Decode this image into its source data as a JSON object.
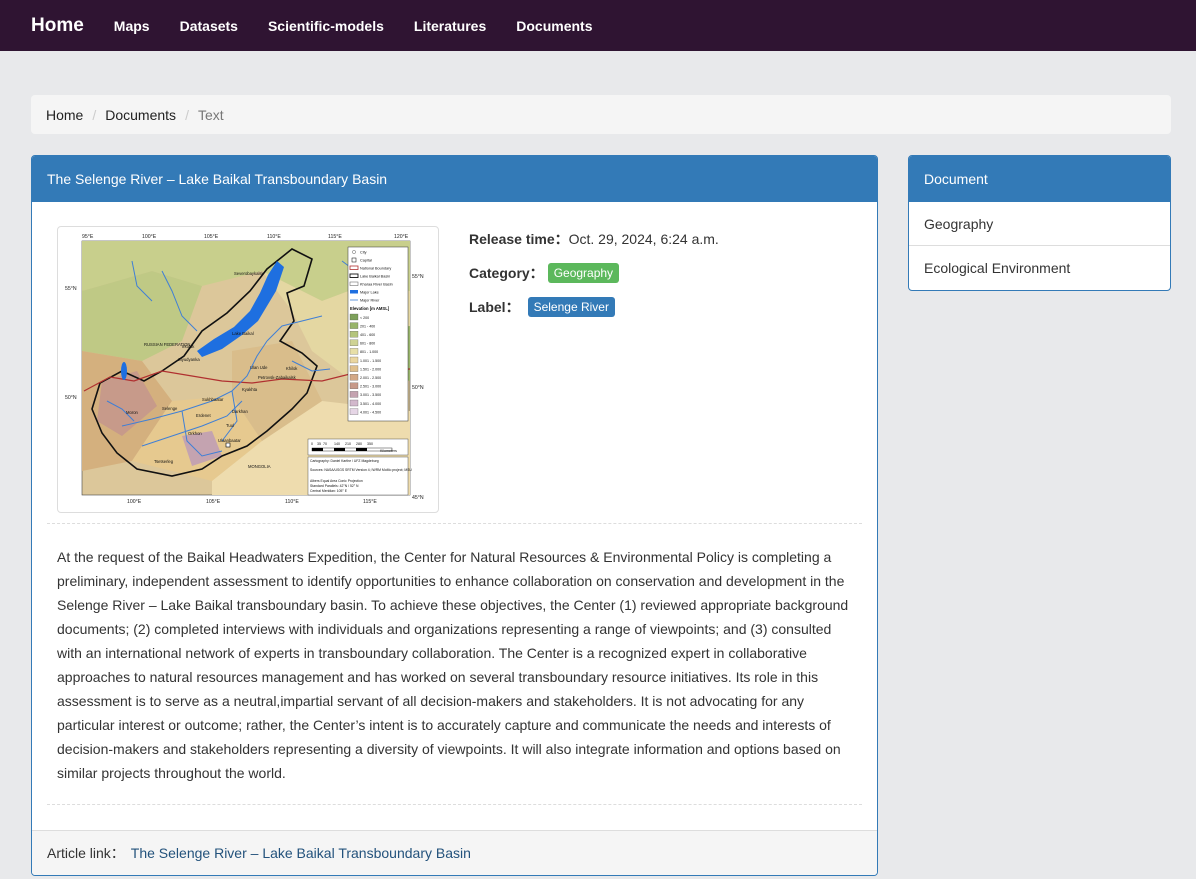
{
  "nav": {
    "brand": "Home",
    "links": [
      "Maps",
      "Datasets",
      "Scientific-models",
      "Literatures",
      "Documents"
    ]
  },
  "breadcrumb": {
    "items": [
      "Home",
      "Documents"
    ],
    "separator": "/",
    "active": "Text"
  },
  "article": {
    "title": "The Selenge River – Lake Baikal Transboundary Basin",
    "release_label": "Release time：",
    "release_value": "Oct. 29, 2024, 6:24 a.m.",
    "category_label": "Category：",
    "category_value": "Geography",
    "tag_label": "Label：",
    "tag_value": "Selenge River",
    "body": "At the request of the Baikal Headwaters Expedition, the Center for Natural Resources & Environmental Policy is completing a preliminary, independent assessment to identify opportunities to enhance collaboration on conservation and development in the Selenge River – Lake Baikal transboundary basin. To achieve these objectives, the Center (1) reviewed appropriate background documents; (2) completed interviews with individuals and organizations representing a range of viewpoints; and (3) consulted with an international network of experts in transboundary collaboration. The Center is a recognized expert in collaborative approaches to natural resources management and has worked on several transboundary resource initiatives. Its role in this assessment is to serve as a neutral,impartial servant of all decision-makers and stakeholders. It is not advocating for any particular interest or outcome; rather, the Center’s intent is to accurately capture and communicate the needs and interests of decision-makers and stakeholders representing a diversity of viewpoints. It will also integrate information and options based on similar projects throughout the world.",
    "footer_label": "Article link：",
    "footer_link": "The Selenge River – Lake Baikal Transboundary Basin"
  },
  "map_image": {
    "top_ticks": [
      "95°E",
      "100°E",
      "105°E",
      "110°E",
      "115°E",
      "120°E"
    ],
    "bottom_ticks": [
      "100°E",
      "105°E",
      "110°E",
      "115°E"
    ],
    "left_ticks": [
      "55°N",
      "50°N"
    ],
    "right_ticks": [
      "55°N",
      "50°N",
      "45°N"
    ],
    "places": [
      "Severobaykalsk",
      "RUSSIAN FEDERATION",
      "Lake Baikal",
      "Irkutsk",
      "Slyudyanka",
      "Ulan Ude",
      "Petrovsk-Zabaikalsk",
      "Kyakhta",
      "Sukhbaatar",
      "Darkhan",
      "Erdenet",
      "Ulaanbaatar",
      "Moron",
      "Selenge",
      "Orkhon",
      "Tuul",
      "Tsetserleg",
      "MONGOLIA",
      "Khilok"
    ],
    "legend_items": [
      "City",
      "Capital",
      "National Boundary",
      "Lake Baikal Basin",
      "Kharaa River Basin",
      "Major Lake",
      "Major River"
    ],
    "legend_title": "Elevation [m AMSL]",
    "legend_classes": [
      "< 200",
      "201 - 400",
      "401 - 600",
      "601 - 800",
      "801 - 1.000",
      "1.001 - 1.500",
      "1.501 - 2.000",
      "2.001 - 2.500",
      "2.501 - 3.000",
      "3.001 - 3.500",
      "3.501 - 4.000",
      "4.001 - 4.500"
    ],
    "legend_colors": [
      "#7da05a",
      "#98b46a",
      "#b4c47c",
      "#cfd393",
      "#e7dfa8",
      "#ead6a0",
      "#dfbf8c",
      "#d3a886",
      "#c79a8a",
      "#c4a3b0",
      "#d2b8cc",
      "#e6d6e6"
    ],
    "scale_ticks": [
      "0",
      "35",
      "70",
      "140",
      "210",
      "280",
      "350"
    ],
    "scale_unit": "Kilometers",
    "credits": [
      "Cartography: Daniel Karthe / UFZ Magdeburg",
      "Sources: NASA/USGS SRTM Version 4; IWRM MoMo project; MSU",
      "Albers Equal Area Conic Projection",
      "Standard Parallels: 42°N / 52° N",
      "Central Meridian: 105° E"
    ]
  },
  "sidebar": {
    "title": "Document",
    "items": [
      "Geography",
      "Ecological Environment"
    ]
  },
  "colors": {
    "navbar": "#2f1432",
    "primary": "#337ab7",
    "success": "#5cb85c",
    "background": "#e8e9eb",
    "lake": "#1e6fe0",
    "river": "#3f7fd6"
  }
}
